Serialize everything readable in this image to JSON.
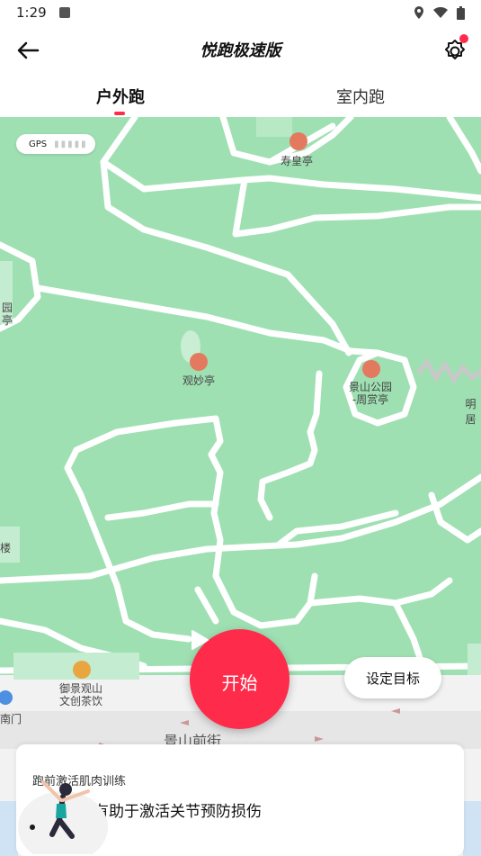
{
  "status_bar": {
    "time": "1:29"
  },
  "header": {
    "title": "悦跑极速版"
  },
  "tabs": [
    {
      "label": "户外跑"
    },
    {
      "label": "室内跑"
    }
  ],
  "map": {
    "gps_label": "GPS",
    "pois": [
      {
        "label": "寿皇亭"
      },
      {
        "label": "观妙亭"
      },
      {
        "label": "景山公园\n-周赏亭"
      },
      {
        "label": "明居"
      },
      {
        "label": "御景观山\n文创茶饮"
      },
      {
        "label": "园\n亭"
      },
      {
        "label": "楼"
      },
      {
        "label": "南门"
      },
      {
        "label": "景山前街"
      }
    ]
  },
  "actions": {
    "start_label": "开始",
    "goal_label": "设定目标"
  },
  "card": {
    "subtitle": "跑前激活肌肉训练",
    "headline": "跑前热身有助于激活关节预防损伤"
  },
  "colors": {
    "accent": "#ff2b4b",
    "map_green": "#9fe0b3"
  }
}
